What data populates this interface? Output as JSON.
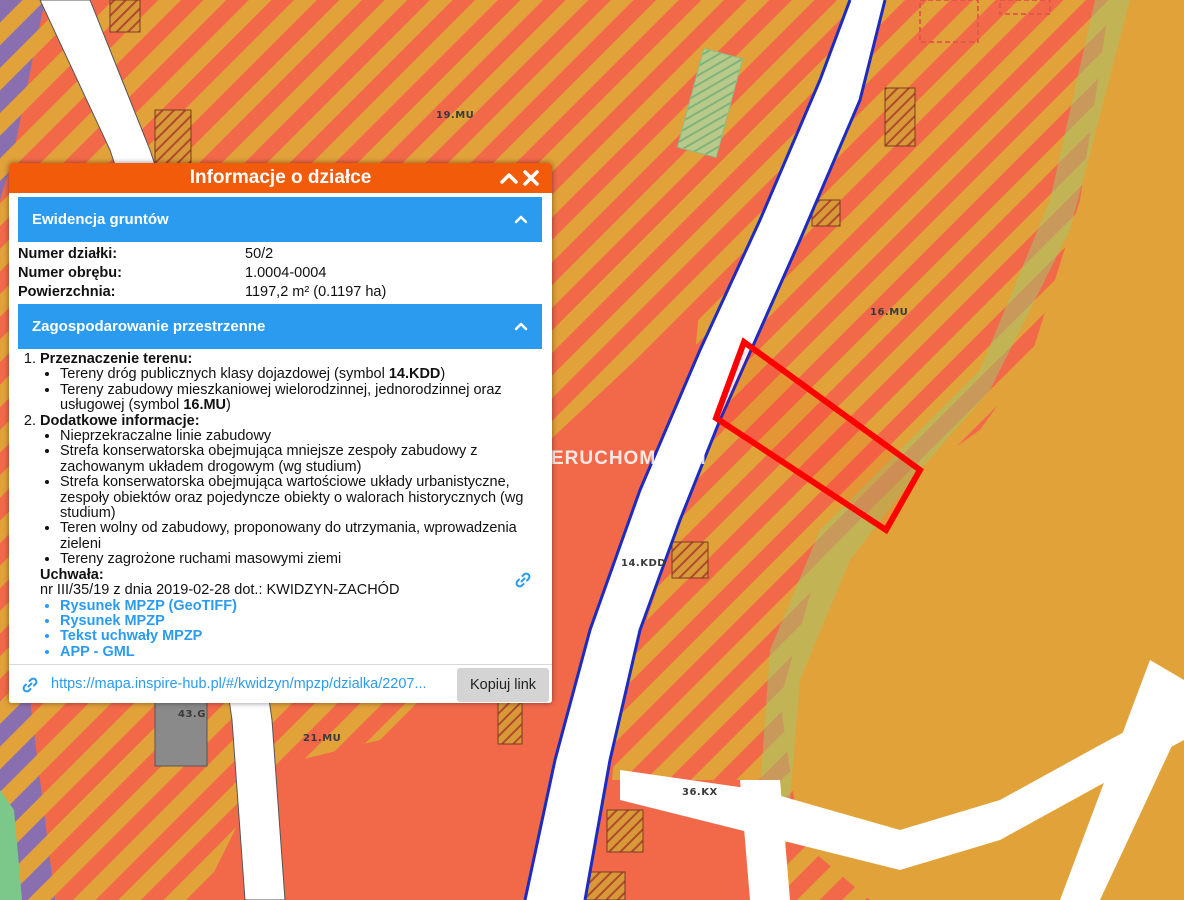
{
  "map": {
    "zones": {
      "z19": "19.MU",
      "z16": "16.MU",
      "z14kdd": "14.KDD",
      "z21": "21.MU",
      "z43": "43.G",
      "z36": "36.KX"
    },
    "watermark": "NIERUCHOMOŚCI",
    "colors": {
      "red_zone": "#f2694a",
      "orange_zone": "#e2a23a",
      "purple_zone": "#8a6fb0",
      "green_zone": "#7cc88a",
      "parcel_outline": "#ff0000",
      "road_border": "#1c2cc0"
    }
  },
  "panel": {
    "title": "Informacje o działce",
    "header_icons": [
      "chevron-up-icon",
      "close-icon"
    ],
    "ewidencja": {
      "title": "Ewidencja gruntów",
      "rows": [
        {
          "label": "Numer działki:",
          "value": "50/2"
        },
        {
          "label": "Numer obrębu:",
          "value": "1.0004-0004"
        },
        {
          "label": "Powierzchnia:",
          "value": "1197,2 m² (0.1197 ha)"
        }
      ]
    },
    "zagospodarowanie": {
      "title": "Zagospodarowanie przestrzenne",
      "przeznaczenie": {
        "title": "Przeznaczenie terenu:",
        "items": [
          {
            "text": "Tereny dróg publicznych klasy dojazdowej (symbol ",
            "symbol": "14.KDD",
            "suffix": ")"
          },
          {
            "text": "Tereny zabudowy mieszkaniowej wielorodzinnej, jednorodzinnej oraz usługowej (symbol ",
            "symbol": "16.MU",
            "suffix": ")"
          }
        ]
      },
      "dodatkowe": {
        "title": "Dodatkowe informacje:",
        "items": [
          "Nieprzekraczalne linie zabudowy",
          "Strefa konserwatorska obejmująca mniejsze zespoły zabudowy z zachowanym układem drogowym (wg studium)",
          "Strefa konserwatorska obejmująca wartościowe układy urbanistyczne, zespoły obiektów oraz pojedyncze obiekty o walorach historycznych (wg studium)",
          "Teren wolny od zabudowy, proponowany do utrzymania, wprowadzenia zieleni",
          "Tereny zagrożone ruchami masowymi ziemi"
        ]
      },
      "uchwala": {
        "title": "Uchwała:",
        "text": "nr III/35/19 z dnia 2019-02-28 dot.: KWIDZYN-ZACHÓD",
        "links": [
          "Rysunek MPZP (GeoTIFF)",
          "Rysunek MPZP",
          "Tekst uchwały MPZP",
          "APP - GML"
        ]
      }
    },
    "footer": {
      "url": "https://mapa.inspire-hub.pl/#/kwidzyn/mpzp/dzialka/2207...",
      "copy_label": "Kopiuj link"
    }
  }
}
